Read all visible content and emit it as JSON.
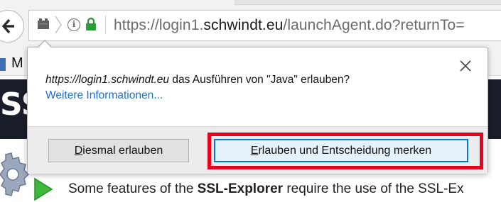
{
  "browser": {
    "url_scheme": "https://login1.",
    "url_host": "schwindt.eu",
    "url_path": "/launchAgent.do?returnTo=",
    "icons": [
      "back-arrow-icon",
      "plugin-icon",
      "info-icon",
      "lock-icon"
    ]
  },
  "page": {
    "bookmark_label": "M",
    "banner_text": "SS",
    "footer_text_pre": "Some features of the ",
    "footer_text_bold": "SSL-Explorer",
    "footer_text_post": " require the use of the SSL-Ex"
  },
  "popup": {
    "site": "https://login1.schwindt.eu",
    "message": " das Ausführen von \"Java\" erlauben?",
    "more_info": "Weitere Informationen...",
    "close_symbol": "✕",
    "button_once_accel": "D",
    "button_once_rest": "iesmal erlauben",
    "button_remember_accel": "E",
    "button_remember_rest": "rlauben und Entscheidung merken"
  },
  "colors": {
    "highlight_frame": "#e8001c",
    "link": "#1f6fd1",
    "lock": "#2a9d3a",
    "focus_border": "#0078d7"
  }
}
